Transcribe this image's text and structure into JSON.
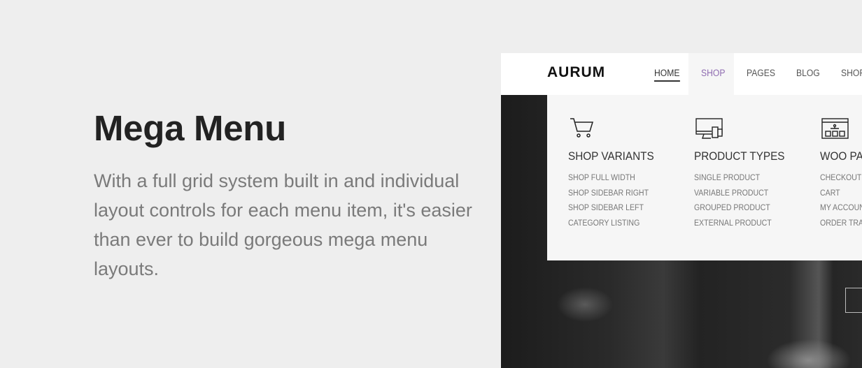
{
  "hero": {
    "title": "Mega Menu",
    "description": "With a full grid system built in and individual layout controls for each menu item, it's easier than ever to build gorgeous mega menu layouts."
  },
  "site": {
    "logo": "AURUM",
    "nav": [
      {
        "label": "HOME",
        "state": "current"
      },
      {
        "label": "SHOP",
        "state": "open"
      },
      {
        "label": "PAGES"
      },
      {
        "label": "BLOG"
      },
      {
        "label": "SHOR"
      }
    ],
    "accent_color": "#8e6bb0",
    "mega_menu": {
      "columns": [
        {
          "icon": "cart-icon",
          "title": "SHOP VARIANTS",
          "items": [
            "SHOP FULL WIDTH",
            "SHOP SIDEBAR RIGHT",
            "SHOP SIDEBAR LEFT",
            "CATEGORY LISTING"
          ]
        },
        {
          "icon": "devices-icon",
          "title": "PRODUCT TYPES",
          "items": [
            "SINGLE PRODUCT",
            "VARIABLE PRODUCT",
            "GROUPED PRODUCT",
            "EXTERNAL PRODUCT"
          ]
        },
        {
          "icon": "sitemap-window-icon",
          "title": "WOO PAG",
          "items": [
            "CHECKOUT",
            "CART",
            "MY ACCOUNT",
            "ORDER TRAC"
          ]
        }
      ]
    }
  }
}
